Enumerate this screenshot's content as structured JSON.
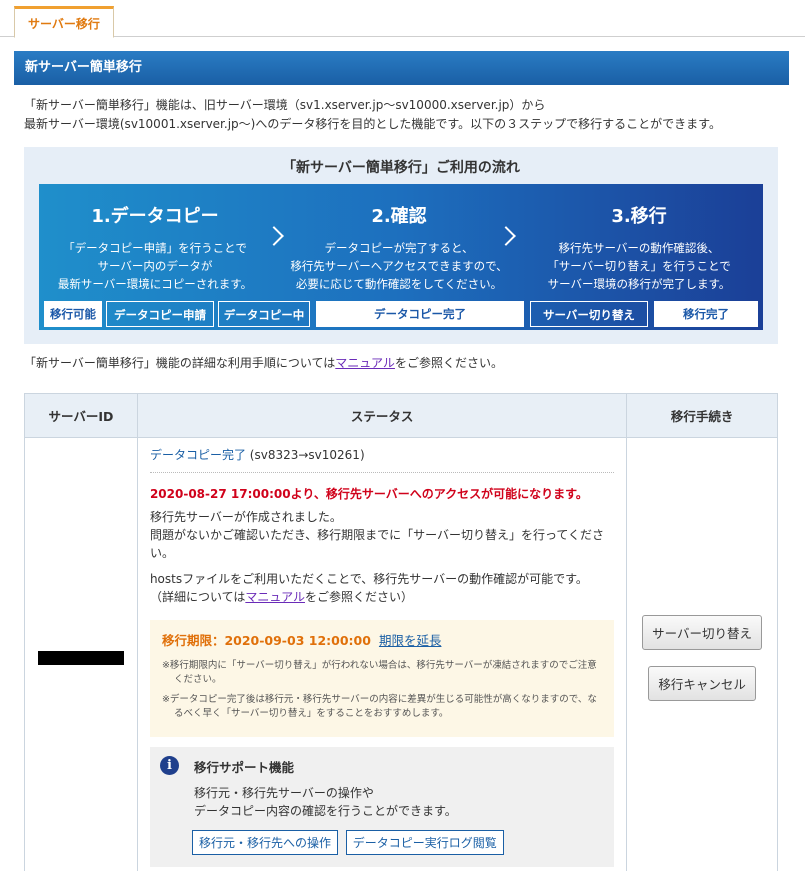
{
  "tab": {
    "label": "サーバー移行"
  },
  "section": {
    "title": "新サーバー簡単移行"
  },
  "intro": {
    "line1": "「新サーバー簡単移行」機能は、旧サーバー環境（sv1.xserver.jp〜sv10000.xserver.jp）から",
    "line2": "最新サーバー環境(sv10001.xserver.jp〜)へのデータ移行を目的とした機能です。以下の３ステップで移行することができます。"
  },
  "flow": {
    "title": "「新サーバー簡単移行」ご利用の流れ",
    "steps": [
      {
        "title": "1.データコピー",
        "desc": [
          "「データコピー申請」を行うことで",
          "サーバー内のデータが",
          "最新サーバー環境にコピーされます。"
        ]
      },
      {
        "title": "2.確認",
        "desc": [
          "データコピーが完了すると、",
          "移行先サーバーへアクセスできますので、",
          "必要に応じて動作確認をしてください。"
        ]
      },
      {
        "title": "3.移行",
        "desc": [
          "移行先サーバーの動作確認後、",
          "「サーバー切り替え」を行うことで",
          "サーバー環境の移行が完了します。"
        ]
      }
    ],
    "track": [
      "移行可能",
      "データコピー申請",
      "データコピー中",
      "データコピー完了",
      "サーバー切り替え",
      "移行完了"
    ]
  },
  "manual_note": {
    "before": "「新サーバー簡単移行」機能の詳細な利用手順については",
    "link": "マニュアル",
    "after": "をご参照ください。"
  },
  "table": {
    "headers": [
      "サーバーID",
      "ステータス",
      "移行手続き"
    ],
    "status": {
      "state": "データコピー完了",
      "detail": "(sv8323→sv10261)",
      "alert": "2020-08-27 17:00:00より、移行先サーバーへのアクセスが可能になります。",
      "msg1": "移行先サーバーが作成されました。",
      "msg2": "問題がないかご確認いただき、移行期限までに「サーバー切り替え」を行ってください。",
      "msg3": "hostsファイルをご利用いただくことで、移行先サーバーの動作確認が可能です。",
      "msg4_before": "（詳細については",
      "msg4_link": "マニュアル",
      "msg4_after": "をご参照ください）",
      "deadline_label": "移行期限：2020-09-03 12:00:00",
      "extend_label": "期限を延長",
      "note1": "※移行期限内に「サーバー切り替え」が行われない場合は、移行先サーバーが凍結されますのでご注意ください。",
      "note2": "※データコピー完了後は移行元・移行先サーバーの内容に差異が生じる可能性が高くなりますので、なるべく早く「サーバー切り替え」をすることをおすすめします。",
      "support_title": "移行サポート機能",
      "support_desc1": "移行元・移行先サーバーの操作や",
      "support_desc2": "データコピー内容の確認を行うことができます。",
      "support_btn1": "移行元・移行先への操作",
      "support_btn2": "データコピー実行ログ閲覧"
    },
    "actions": {
      "switch": "サーバー切り替え",
      "cancel": "移行キャンセル"
    }
  },
  "colors": {
    "header_blue": "#1a5fa5",
    "alert_red": "#d0021b",
    "deadline_orange": "#e0700a",
    "tab_orange": "#e07a10"
  }
}
